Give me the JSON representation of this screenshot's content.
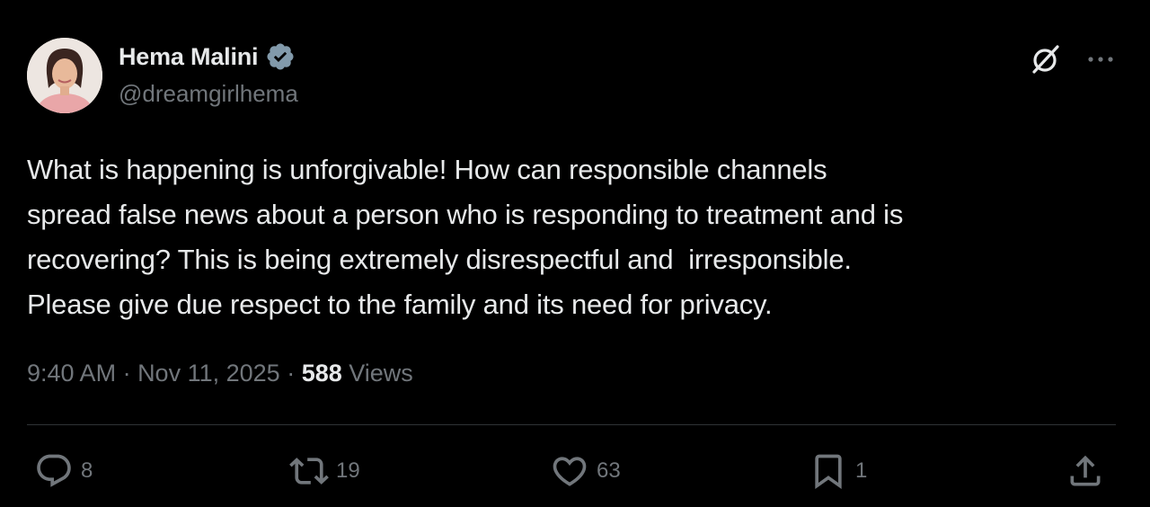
{
  "author": {
    "display_name": "Hema Malini",
    "handle": "@dreamgirlhema",
    "verified": true,
    "avatar_icon": "profile-photo"
  },
  "tweet": {
    "lines": [
      "What is happening is unforgivable! How can responsible channels",
      "spread false news about a person who is responding to treatment and is",
      "recovering? This is being extremely disrespectful and  irresponsible.",
      "Please give due respect to the family and its need for privacy."
    ],
    "time": "9:40 AM",
    "separator": " · ",
    "date": "Nov 11, 2025",
    "views_count": "588",
    "views_label": " Views"
  },
  "top_actions": {
    "grok_icon": "grok-icon",
    "more_icon": "more-icon"
  },
  "actions": {
    "reply": {
      "icon": "reply-icon",
      "count": "8"
    },
    "repost": {
      "icon": "repost-icon",
      "count": "19"
    },
    "like": {
      "icon": "like-icon",
      "count": "63"
    },
    "bookmark": {
      "icon": "bookmark-icon",
      "count": "1"
    },
    "share": {
      "icon": "share-icon"
    }
  },
  "colors": {
    "background": "#000000",
    "text_primary": "#e7e9ea",
    "text_secondary": "#71767b",
    "verified_badge": "#829aab",
    "divider": "#2f3336"
  }
}
